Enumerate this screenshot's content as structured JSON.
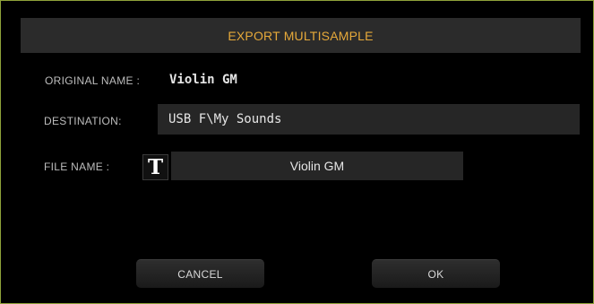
{
  "dialog": {
    "title": "EXPORT MULTISAMPLE",
    "original_name_label": "ORIGINAL NAME :",
    "original_name_value": "Violin GM",
    "destination_label": "DESTINATION:",
    "destination_value": "USB F\\My Sounds",
    "file_name_label": "FILE NAME :",
    "text_edit_icon": "T",
    "file_name_value": "Violin GM",
    "cancel_label": "CANCEL",
    "ok_label": "OK"
  },
  "colors": {
    "title_accent": "#e6a93a",
    "frame_border": "#8fa23a",
    "background": "#000000",
    "field_background": "#262626"
  },
  "icons": {
    "text_edit": "text-edit-icon"
  }
}
